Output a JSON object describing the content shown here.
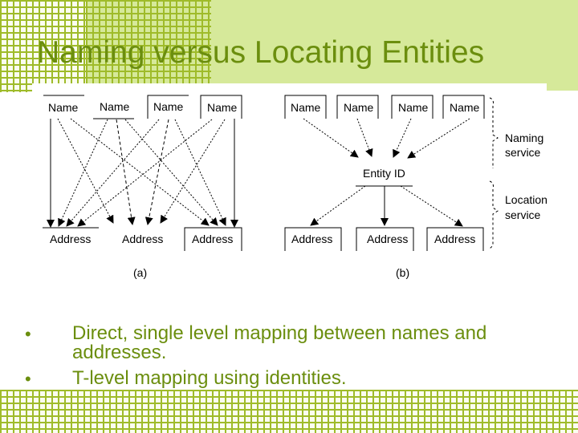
{
  "slide": {
    "title": "Naming versus Locating Entities",
    "colors": {
      "title_text": "#6b8e0e",
      "header_bg": "#d6e99a",
      "grid_line": "#9fbb2a",
      "diagram_ink": "#000000"
    }
  },
  "diagram_a": {
    "names": [
      "Name",
      "Name",
      "Name",
      "Name"
    ],
    "addresses": [
      "Address",
      "Address",
      "Address"
    ],
    "caption": "(a)"
  },
  "diagram_b": {
    "names": [
      "Name",
      "Name",
      "Name",
      "Name"
    ],
    "entity": "Entity ID",
    "addresses": [
      "Address",
      "Address",
      "Address"
    ],
    "caption": "(b)",
    "brace_labels": {
      "naming": [
        "Naming",
        "service"
      ],
      "location": [
        "Location",
        "service"
      ]
    }
  },
  "bullets": [
    {
      "marker": "•",
      "lines": [
        "Direct, single level mapping between names and",
        "addresses."
      ]
    },
    {
      "marker": "•",
      "lines": [
        "T-level mapping using identities."
      ]
    }
  ]
}
